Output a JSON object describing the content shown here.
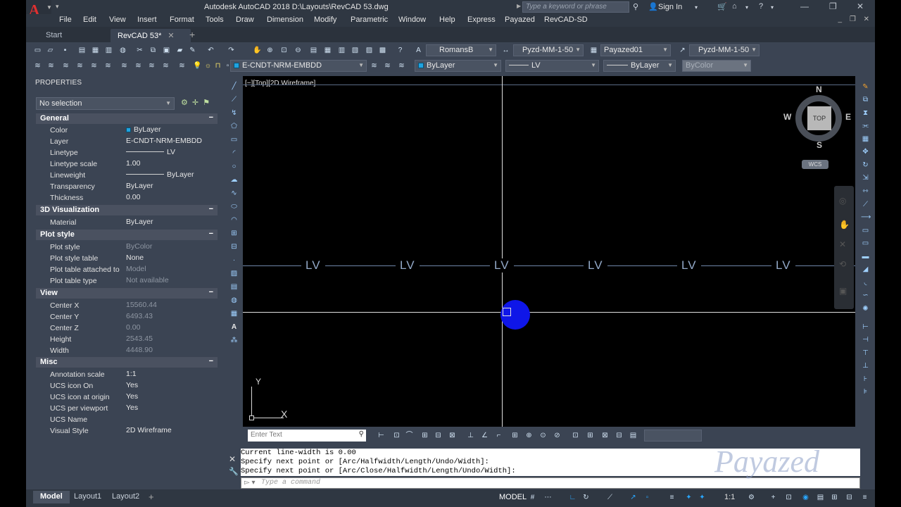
{
  "app": {
    "title": "Autodesk AutoCAD 2018    D:\\Layouts\\RevCAD 53.dwg",
    "search_placeholder": "Type a keyword or phrase",
    "sign_in": "Sign In"
  },
  "menu": [
    "File",
    "Edit",
    "View",
    "Insert",
    "Format",
    "Tools",
    "Draw",
    "Dimension",
    "Modify",
    "Parametric",
    "Window",
    "Help",
    "Express",
    "Payazed",
    "RevCAD-SD"
  ],
  "tabs": {
    "start": "Start",
    "active": "RevCAD 53*"
  },
  "toolbar": {
    "text_style": "RomansB",
    "dim_style": "Pyzd-MM-1-50",
    "table_style": "Payazed01",
    "mleader_style": "Pyzd-MM-1-50",
    "layer": "E-CNDT-NRM-EMBDD",
    "color": "ByLayer",
    "linetype": "LV",
    "lineweight": "ByLayer",
    "plotstyle": "ByColor"
  },
  "properties": {
    "title": "PROPERTIES",
    "selection": "No selection",
    "groups": {
      "general": "General",
      "viz3d": "3D Visualization",
      "plot": "Plot style",
      "view": "View",
      "misc": "Misc"
    },
    "general": {
      "color_k": "Color",
      "color_v": "ByLayer",
      "layer_k": "Layer",
      "layer_v": "E-CNDT-NRM-EMBDD",
      "linetype_k": "Linetype",
      "linetype_v": "LV",
      "ltscale_k": "Linetype scale",
      "ltscale_v": "1.00",
      "lweight_k": "Lineweight",
      "lweight_v": "ByLayer",
      "transp_k": "Transparency",
      "transp_v": "ByLayer",
      "thick_k": "Thickness",
      "thick_v": "0.00"
    },
    "viz3d": {
      "material_k": "Material",
      "material_v": "ByLayer"
    },
    "plot": {
      "ps_k": "Plot style",
      "ps_v": "ByColor",
      "pst_k": "Plot style table",
      "pst_v": "None",
      "pta_k": "Plot table attached to",
      "pta_v": "Model",
      "ptt_k": "Plot table type",
      "ptt_v": "Not available"
    },
    "view": {
      "cx_k": "Center X",
      "cx_v": "15560.44",
      "cy_k": "Center Y",
      "cy_v": "6493.43",
      "cz_k": "Center Z",
      "cz_v": "0.00",
      "h_k": "Height",
      "h_v": "2543.45",
      "w_k": "Width",
      "w_v": "4448.90"
    },
    "misc": {
      "as_k": "Annotation scale",
      "as_v": "1:1",
      "ucson_k": "UCS icon On",
      "ucson_v": "Yes",
      "ucsorg_k": "UCS icon at origin",
      "ucsorg_v": "Yes",
      "ucsvp_k": "UCS per viewport",
      "ucsvp_v": "Yes",
      "ucsname_k": "UCS Name",
      "ucsname_v": "",
      "vs_k": "Visual Style",
      "vs_v": "2D Wireframe"
    }
  },
  "viewport": {
    "label": "[−][Top][2D Wireframe]",
    "linetype_label": "LV",
    "viewcube": {
      "n": "N",
      "s": "S",
      "e": "E",
      "w": "W",
      "top": "TOP",
      "wcs": "WCS"
    },
    "ucs": {
      "x": "X",
      "y": "Y"
    }
  },
  "input": {
    "placeholder": "Enter Text"
  },
  "command": {
    "lines": [
      "Current line-width is 0.00",
      "Specify next point or [Arc/Halfwidth/Length/Undo/Width]:",
      "Specify next point or [Arc/Close/Halfwidth/Length/Undo/Width]:"
    ],
    "placeholder": "Type a command"
  },
  "watermark": "Payazed",
  "status": {
    "model_tab": "Model",
    "layout1": "Layout1",
    "layout2": "Layout2",
    "model": "MODEL",
    "scale": "1:1"
  }
}
